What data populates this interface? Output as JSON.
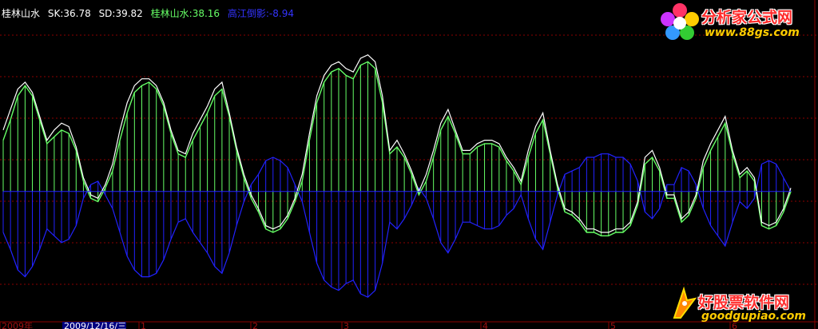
{
  "legend": {
    "name": "桂林山水",
    "sk_label": "SK:36.78",
    "sd_label": "SD:39.82",
    "series_label": "桂林山水:38.16",
    "series2_label": "高江倒影:-8.94"
  },
  "colors": {
    "background": "#000000",
    "sk_line": "#ffffff",
    "green": "#66ff66",
    "blue": "#2222ff",
    "grid": "#8b0000",
    "axis_text": "#a01010",
    "selected_date_bg": "#000080",
    "selected_date_text": "#ffffff"
  },
  "axis": {
    "labels": [
      "2009年",
      "1",
      "2",
      "3",
      "4",
      "5",
      "6"
    ],
    "selected_date": "2009/12/16/三"
  },
  "logos": {
    "top_name": "分析家公式网",
    "top_url": "www.88gs.com",
    "bottom_name": "好股票软件网",
    "bottom_url": "goodgupiao.com"
  },
  "chart_data": {
    "type": "line",
    "series": [
      {
        "name": "SK",
        "values": [
          36,
          48,
          60,
          64,
          58,
          44,
          30,
          36,
          40,
          38,
          26,
          8,
          -2,
          -4,
          4,
          16,
          36,
          52,
          62,
          66,
          66,
          62,
          52,
          36,
          24,
          22,
          34,
          42,
          50,
          60,
          64,
          46,
          26,
          10,
          -2,
          -10,
          -20,
          -22,
          -20,
          -14,
          -4,
          10,
          34,
          56,
          68,
          74,
          76,
          72,
          70,
          78,
          80,
          76,
          56,
          24,
          30,
          22,
          12,
          0,
          10,
          24,
          40,
          48,
          36,
          24,
          24,
          28,
          30,
          30,
          28,
          20,
          14,
          6,
          24,
          38,
          46,
          24,
          4,
          -10,
          -12,
          -16,
          -22,
          -22,
          -24,
          -24,
          -22,
          -22,
          -18,
          -6,
          20,
          24,
          14,
          -2,
          -2,
          -16,
          -12,
          -2,
          18,
          28,
          36,
          44,
          24,
          10,
          14,
          8,
          -18,
          -20,
          -18,
          -10,
          2
        ]
      },
      {
        "name": "SD",
        "values": [
          30,
          42,
          56,
          62,
          56,
          42,
          28,
          32,
          36,
          34,
          24,
          6,
          -4,
          -6,
          2,
          12,
          30,
          46,
          58,
          62,
          64,
          60,
          50,
          34,
          22,
          20,
          30,
          38,
          46,
          56,
          60,
          44,
          24,
          8,
          -4,
          -12,
          -22,
          -24,
          -22,
          -16,
          -6,
          6,
          30,
          52,
          64,
          70,
          72,
          68,
          66,
          74,
          76,
          72,
          52,
          22,
          26,
          20,
          10,
          -2,
          6,
          20,
          36,
          44,
          34,
          22,
          22,
          26,
          28,
          28,
          26,
          18,
          12,
          4,
          20,
          34,
          42,
          22,
          2,
          -12,
          -14,
          -18,
          -24,
          -24,
          -26,
          -26,
          -24,
          -24,
          -20,
          -8,
          16,
          20,
          12,
          -4,
          -4,
          -18,
          -14,
          -4,
          14,
          24,
          32,
          40,
          22,
          8,
          12,
          6,
          -20,
          -22,
          -20,
          -12,
          0
        ]
      },
      {
        "name": "桂林山水",
        "values": [
          30,
          42,
          56,
          62,
          56,
          42,
          28,
          32,
          36,
          34,
          24,
          6,
          -4,
          -6,
          2,
          12,
          30,
          46,
          58,
          62,
          64,
          60,
          50,
          34,
          22,
          20,
          30,
          38,
          46,
          56,
          60,
          44,
          24,
          8,
          -4,
          -12,
          -22,
          -24,
          -22,
          -16,
          -6,
          6,
          30,
          52,
          64,
          70,
          72,
          68,
          66,
          74,
          76,
          72,
          52,
          22,
          26,
          20,
          10,
          -2,
          6,
          20,
          36,
          44,
          34,
          22,
          22,
          26,
          28,
          28,
          26,
          18,
          12,
          4,
          20,
          34,
          42,
          22,
          2,
          -12,
          -14,
          -18,
          -24,
          -24,
          -26,
          -26,
          -24,
          -24,
          -20,
          -8,
          16,
          20,
          12,
          -4,
          -4,
          -18,
          -14,
          -4,
          14,
          24,
          32,
          40,
          22,
          8,
          12,
          6,
          -20,
          -22,
          -20,
          -12,
          0
        ]
      },
      {
        "name": "高江倒影",
        "values": [
          -24,
          -34,
          -46,
          -50,
          -44,
          -34,
          -22,
          -26,
          -30,
          -28,
          -20,
          -4,
          4,
          6,
          -2,
          -10,
          -24,
          -38,
          -46,
          -50,
          -50,
          -48,
          -40,
          -28,
          -18,
          -16,
          -24,
          -30,
          -36,
          -44,
          -48,
          -36,
          -20,
          -6,
          4,
          10,
          18,
          20,
          18,
          14,
          4,
          -6,
          -24,
          -42,
          -52,
          -56,
          -58,
          -54,
          -52,
          -60,
          -62,
          -58,
          -42,
          -18,
          -22,
          -16,
          -8,
          2,
          -4,
          -16,
          -30,
          -36,
          -28,
          -18,
          -18,
          -20,
          -22,
          -22,
          -20,
          -14,
          -10,
          -2,
          -16,
          -28,
          -34,
          -18,
          -2,
          10,
          12,
          14,
          20,
          20,
          22,
          22,
          20,
          20,
          16,
          6,
          -12,
          -16,
          -10,
          4,
          4,
          14,
          12,
          4,
          -10,
          -20,
          -26,
          -32,
          -18,
          -6,
          -10,
          -4,
          16,
          18,
          16,
          8,
          0
        ]
      }
    ],
    "ylim": [
      -75,
      100
    ],
    "grid": true
  }
}
